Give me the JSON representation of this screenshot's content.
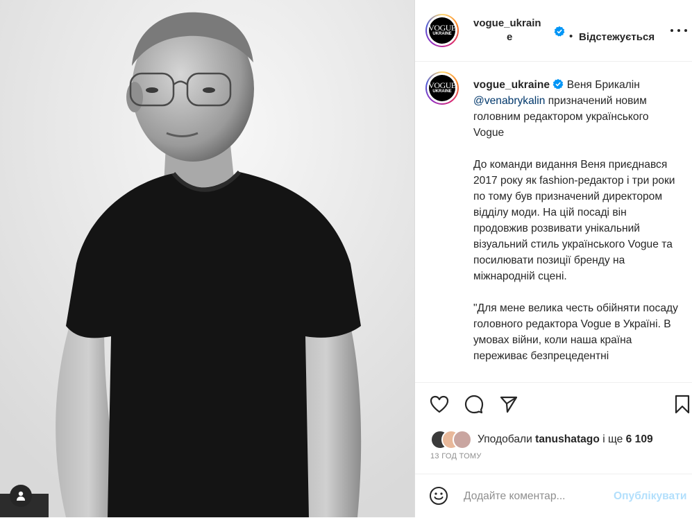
{
  "post": {
    "author": "vogue_ukraine",
    "author_line1": "vogue_ukrain",
    "author_line2": "e",
    "follow_status": "Відстежується",
    "follow_dot": "•",
    "caption": {
      "username": "vogue_ukraine",
      "lead": "Веня Брикалін",
      "mention": "@venabrykalin",
      "lead_rest": "призначений новим головним редактором українського Vogue",
      "paragraph2": "До команди видання Веня приєднався 2017 року як fashion-редактор і три роки по тому був призначений директором відділу моди. На цій посаді він продовжив розвивати унікальний візуальний стиль українського Vogue та посилювати позиції бренду на міжнародній сцені.",
      "paragraph3": "\"Для мене велика честь обійняти посаду головного редактора Vogue в Україні. В умовах війни, коли наша країна переживає безпрецедентні"
    },
    "likes": {
      "prefix": "Уподобали",
      "user": "tanushatago",
      "middle": "і ще",
      "count": "6 109"
    },
    "time_ago": "13 ГОД ТОМУ",
    "comment": {
      "placeholder": "Додайте коментар...",
      "publish_label": "Опублікувати"
    }
  },
  "logo": {
    "line1": "VOGUE",
    "line2": "UKRAINE"
  },
  "icons": {
    "heart": "heart-icon",
    "comment": "comment-icon",
    "share": "share-icon",
    "save": "bookmark-icon",
    "emoji": "emoji-icon",
    "verified": "verified-icon",
    "tagged_user": "user-icon",
    "more": "more-icon"
  },
  "colors": {
    "link": "#00376b",
    "verified": "#0095f6",
    "publish_disabled": "#b2dffc",
    "muted": "#8e8e8e"
  }
}
